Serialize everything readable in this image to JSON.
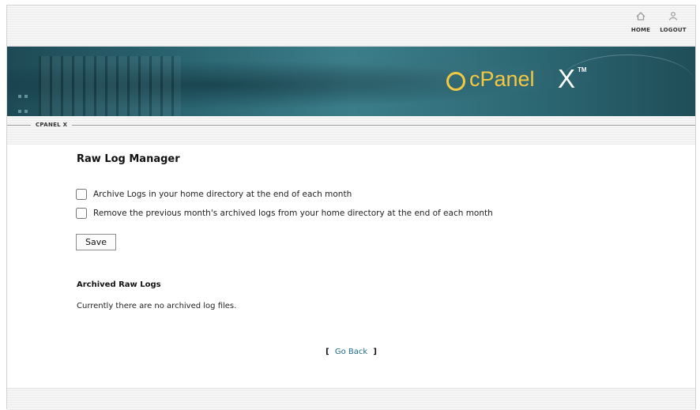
{
  "top_links": {
    "home_label": "HOME",
    "logout_label": "LOGOUT"
  },
  "banner": {
    "logo_text": "cPanel",
    "logo_version": "X",
    "logo_tm": "TM",
    "accent_color": "#f5c842"
  },
  "breadcrumb": {
    "label": "CPANEL X"
  },
  "page": {
    "title": "Raw Log Manager",
    "options": [
      {
        "label": "Archive Logs in your home directory at the end of each month",
        "checked": false
      },
      {
        "label": "Remove the previous month's archived logs from your home directory at the end of each month",
        "checked": false
      }
    ],
    "save_label": "Save",
    "archived_title": "Archived Raw Logs",
    "archived_empty": "Currently there are no archived log files.",
    "go_back": {
      "open_bracket": "[",
      "label": "Go Back",
      "close_bracket": "]"
    }
  },
  "icons": {
    "home": "home-icon",
    "logout": "logout-icon"
  }
}
